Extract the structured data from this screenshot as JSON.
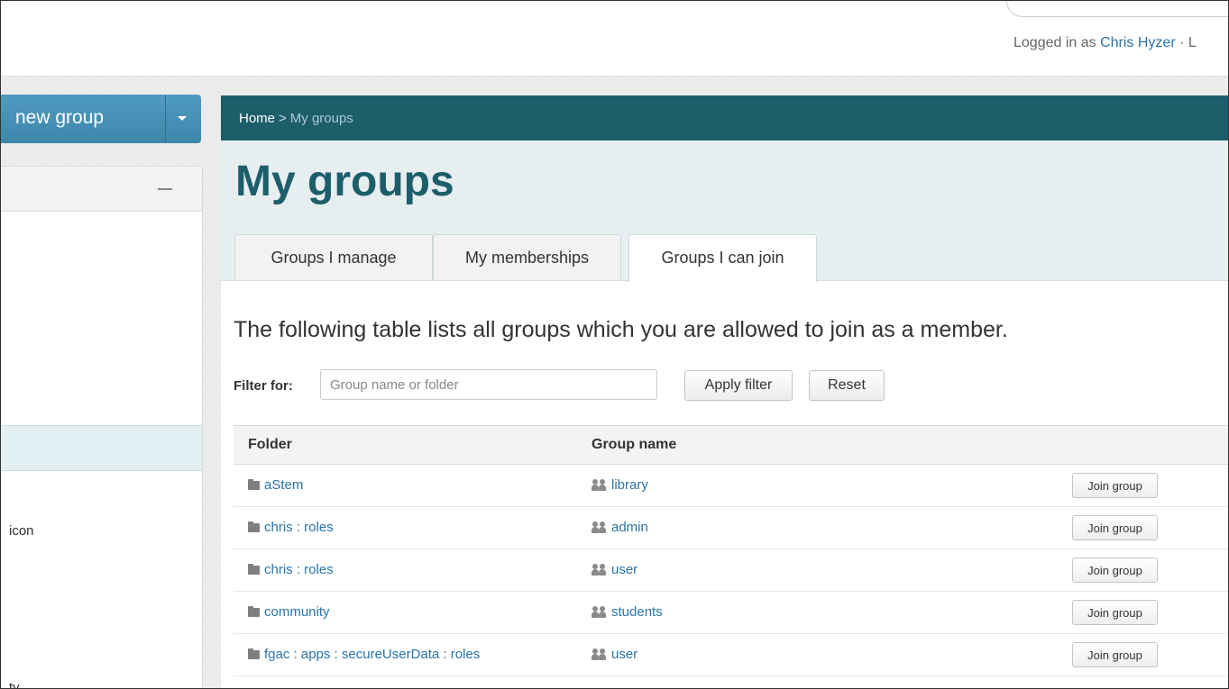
{
  "header": {
    "login_prefix": "Logged in as",
    "user_name": "Chris Hyzer",
    "login_suffix": "· L"
  },
  "sidebar": {
    "new_group_label": "new group",
    "fragment_1": "icon",
    "fragment_2": "ty"
  },
  "breadcrumb": {
    "home": "Home",
    "separator": ">",
    "current": "My groups"
  },
  "page": {
    "title": "My groups",
    "tabs": [
      {
        "label": "Groups I manage",
        "active": false
      },
      {
        "label": "My memberships",
        "active": false
      },
      {
        "label": "Groups I can join",
        "active": true
      }
    ],
    "intro": "The following table lists all groups which you are allowed to join as a member."
  },
  "filter": {
    "label": "Filter for:",
    "value": "",
    "placeholder": "Group name or folder",
    "apply_label": "Apply filter",
    "reset_label": "Reset"
  },
  "table": {
    "columns": [
      "Folder",
      "Group name"
    ],
    "join_label": "Join group",
    "rows": [
      {
        "folder": "aStem",
        "group": "library"
      },
      {
        "folder": "chris : roles",
        "group": "admin"
      },
      {
        "folder": "chris : roles",
        "group": "user"
      },
      {
        "folder": "community",
        "group": "students"
      },
      {
        "folder": "fgac : apps : secureUserData : roles",
        "group": "user"
      }
    ]
  },
  "colors": {
    "accent": "#1d5e6b",
    "link": "#2a74a8",
    "button_blue": "#4f9bbf",
    "header_bg": "#e6eef0"
  }
}
